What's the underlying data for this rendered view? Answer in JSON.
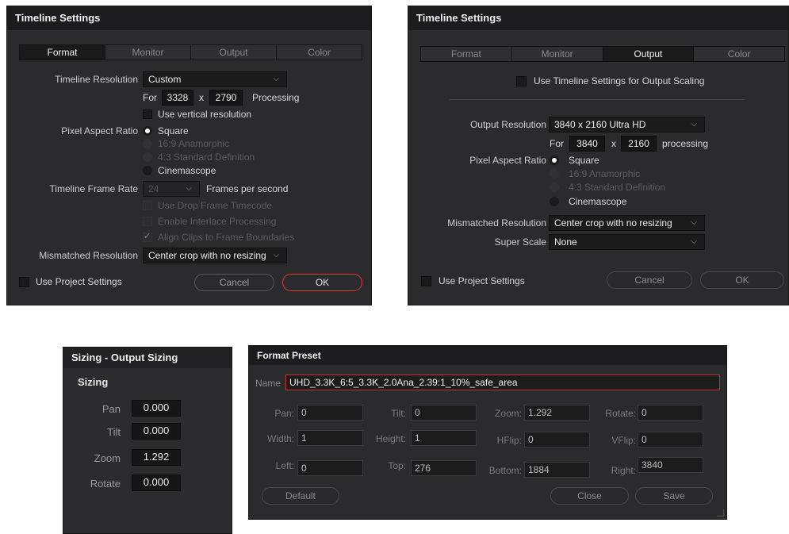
{
  "panel1": {
    "title": "Timeline Settings",
    "tabs": [
      "Format",
      "Monitor",
      "Output",
      "Color"
    ],
    "timeline_resolution_label": "Timeline Resolution",
    "timeline_resolution_value": "Custom",
    "for_label": "For",
    "width": "3328",
    "x_label": "x",
    "height": "2790",
    "processing_label": "Processing",
    "use_vertical_label": "Use vertical resolution",
    "pixel_aspect_label": "Pixel Aspect Ratio",
    "aspect_options": [
      "Square",
      "16:9 Anamorphic",
      "4:3 Standard Definition",
      "Cinemascope"
    ],
    "frame_rate_label": "Timeline Frame Rate",
    "frame_rate_value": "24",
    "fps_label": "Frames per second",
    "drop_frame_label": "Use Drop Frame Timecode",
    "interlace_label": "Enable Interlace Processing",
    "align_clips_label": "Align Clips to Frame Boundaries",
    "mismatched_label": "Mismatched Resolution",
    "mismatched_value": "Center crop with no resizing",
    "use_project_label": "Use Project Settings",
    "cancel_label": "Cancel",
    "ok_label": "OK"
  },
  "panel2": {
    "title": "Timeline Settings",
    "tabs": [
      "Format",
      "Monitor",
      "Output",
      "Color"
    ],
    "use_timeline_label": "Use Timeline Settings for Output Scaling",
    "output_resolution_label": "Output Resolution",
    "output_resolution_value": "3840 x 2160 Ultra HD",
    "for_label": "For",
    "width": "3840",
    "x_label": "x",
    "height": "2160",
    "processing_label": "processing",
    "pixel_aspect_label": "Pixel Aspect Ratio",
    "aspect_options": [
      "Square",
      "16:9 Anamorphic",
      "4:3 Standard Definition",
      "Cinemascope"
    ],
    "mismatched_label": "Mismatched Resolution",
    "mismatched_value": "Center crop with no resizing",
    "super_scale_label": "Super Scale",
    "super_scale_value": "None",
    "use_project_label": "Use Project Settings",
    "cancel_label": "Cancel",
    "ok_label": "OK"
  },
  "panel3": {
    "title": "Sizing - Output Sizing",
    "section": "Sizing",
    "pan_label": "Pan",
    "pan_value": "0.000",
    "tilt_label": "Tilt",
    "tilt_value": "0.000",
    "zoom_label": "Zoom",
    "zoom_value": "1.292",
    "rotate_label": "Rotate",
    "rotate_value": "0.000"
  },
  "panel4": {
    "title": "Format Preset",
    "name_label": "Name",
    "name_value": "UHD_3.3K_6:5_3.3K_2.0Ana_2.39:1_10%_safe_area",
    "pan_label": "Pan:",
    "pan_value": "0",
    "tilt_label": "Tilt:",
    "tilt_value": "0",
    "zoom_label": "Zoom:",
    "zoom_value": "1.292",
    "rotate_label": "Rotate:",
    "rotate_value": "0",
    "width_label": "Width:",
    "width_value": "1",
    "height_label": "Height:",
    "height_value": "1",
    "hflip_label": "HFlip:",
    "hflip_value": "0",
    "vflip_label": "VFlip:",
    "vflip_value": "0",
    "left_label": "Left:",
    "left_value": "0",
    "top_label": "Top:",
    "top_value": "276",
    "bottom_label": "Bottom:",
    "bottom_value": "1884",
    "right_label": "Right:",
    "right_value": "3840",
    "default_label": "Default",
    "close_label": "Close",
    "save_label": "Save"
  },
  "colors": {
    "accent_red": "#d93a34",
    "panel_bg": "#2b2b2d",
    "titlebar_bg": "#1c1c1e"
  },
  "icons": {
    "dropdown": "chevron-down-icon",
    "checkmark": "checkmark-icon"
  }
}
